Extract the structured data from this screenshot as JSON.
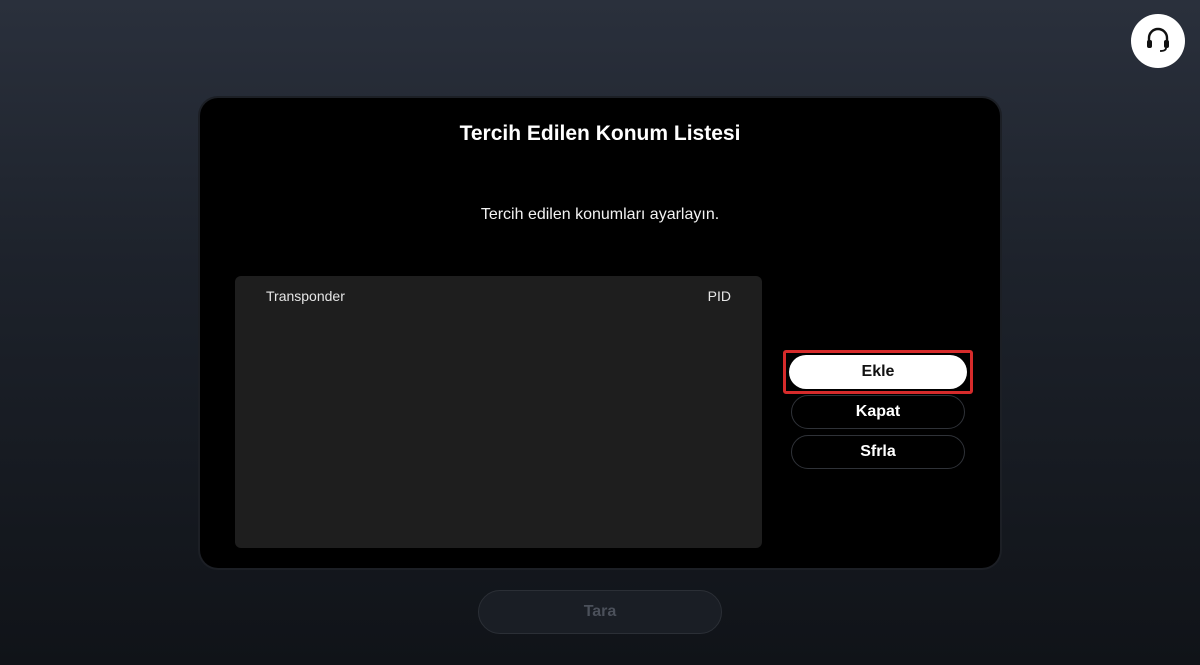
{
  "dialog": {
    "title": "Tercih Edilen Konum Listesi",
    "subtitle": "Tercih edilen konumları ayarlayın.",
    "list": {
      "columns": [
        "Transponder",
        "PID"
      ],
      "rows": []
    },
    "buttons": {
      "add_label": "Ekle",
      "close_label": "Kapat",
      "reset_label": "Sfrla"
    }
  },
  "footer": {
    "scan_label": "Tara"
  },
  "icons": {
    "support": "headset-icon"
  },
  "colors": {
    "focus": "#d62b2b",
    "dialog_bg": "#000000",
    "list_bg": "#1e1e1e"
  }
}
